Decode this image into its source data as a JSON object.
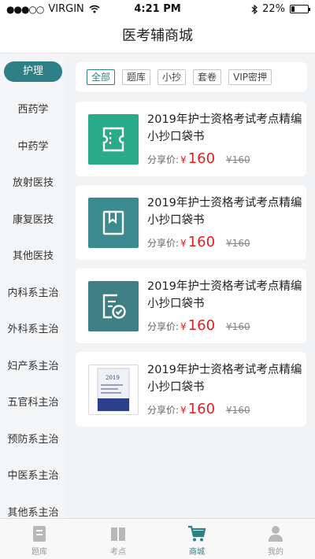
{
  "status_bar": {
    "signal": "●●●○○",
    "carrier": "VIRGIN",
    "time": "4:21 PM",
    "battery": "22%",
    "battery_level": 0.22
  },
  "nav": {
    "title": "医考辅商城"
  },
  "sidebar": {
    "items": [
      {
        "label": "护理",
        "active": true
      },
      {
        "label": "西药学"
      },
      {
        "label": "中药学"
      },
      {
        "label": "放射医技"
      },
      {
        "label": "康复医技"
      },
      {
        "label": "其他医技"
      },
      {
        "label": "内科系主治"
      },
      {
        "label": "外科系主治"
      },
      {
        "label": "妇产系主治"
      },
      {
        "label": "五官科主治"
      },
      {
        "label": "预防系主治"
      },
      {
        "label": "中医系主治"
      },
      {
        "label": "其他系主治"
      }
    ]
  },
  "filters": [
    {
      "label": "全部",
      "active": true
    },
    {
      "label": "题库"
    },
    {
      "label": "小抄"
    },
    {
      "label": "套卷"
    },
    {
      "label": "VIP密押"
    }
  ],
  "products": [
    {
      "title": "2019年护士资格考试考点精编小抄口袋书",
      "price_label": "分享价:",
      "currency": "¥",
      "price": "160",
      "original_price": "¥160",
      "icon": "ticket-icon",
      "thumb_color": "#2aaa8a"
    },
    {
      "title": "2019年护士资格考试考点精编小抄口袋书",
      "price_label": "分享价:",
      "currency": "¥",
      "price": "160",
      "original_price": "¥160",
      "icon": "bookmark-book-icon",
      "thumb_color": "#3b8a8f"
    },
    {
      "title": "2019年护士资格考试考点精编小抄口袋书",
      "price_label": "分享价:",
      "currency": "¥",
      "price": "160",
      "original_price": "¥160",
      "icon": "checked-document-icon",
      "thumb_color": "#3e7f86"
    },
    {
      "title": "2019年护士资格考试考点精编小抄口袋书",
      "price_label": "分享价:",
      "currency": "¥",
      "price": "160",
      "original_price": "¥160",
      "icon": "book-cover-image",
      "cover_text": "2019"
    }
  ],
  "tabbar": {
    "items": [
      {
        "label": "题库",
        "icon": "question-bank-icon"
      },
      {
        "label": "考点",
        "icon": "open-book-icon"
      },
      {
        "label": "商城",
        "icon": "cart-icon",
        "active": true
      },
      {
        "label": "我的",
        "icon": "user-icon"
      }
    ]
  },
  "colors": {
    "accent": "#2f7f86",
    "price": "#e02020",
    "thumb_green": "#2aaa8a"
  }
}
